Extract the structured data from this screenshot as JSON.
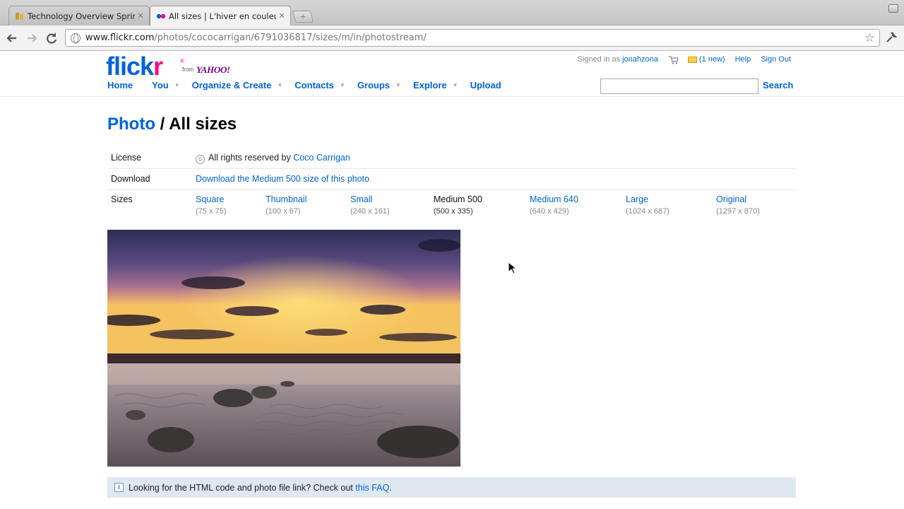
{
  "browser": {
    "tabs": [
      {
        "title": "Technology Overview Spring"
      },
      {
        "title": "All sizes | L'hiver en couleurs"
      }
    ],
    "new_tab_glyph": "+",
    "url_host": "www.flickr.com",
    "url_path": "/photos/cococarrigan/6791036817/sizes/m/in/photostream/"
  },
  "header": {
    "logo_text": "flickr",
    "logo_reg": "®",
    "from_label": "from",
    "yahoo_label": "YAHOO!",
    "signed_in_label": "Signed in as",
    "username": "jonahzona",
    "mail_count": "(1 new)",
    "help": "Help",
    "sign_out": "Sign Out",
    "nav": [
      {
        "label": "Home",
        "has_menu": false
      },
      {
        "label": "You",
        "has_menu": true
      },
      {
        "label": "Organize & Create",
        "has_menu": true
      },
      {
        "label": "Contacts",
        "has_menu": true
      },
      {
        "label": "Groups",
        "has_menu": true
      },
      {
        "label": "Explore",
        "has_menu": true
      },
      {
        "label": "Upload",
        "has_menu": false
      }
    ],
    "search_value": "",
    "search_button": "Search"
  },
  "main": {
    "heading_link": "Photo",
    "heading_rest": " / All sizes",
    "license_label": "License",
    "license_text": "All rights reserved by",
    "license_owner": "Coco Carrigan",
    "download_label": "Download",
    "download_link": "Download the Medium 500 size of this photo",
    "sizes_label": "Sizes",
    "sizes": [
      {
        "name": "Square",
        "dims": "(75 x 75)",
        "current": false
      },
      {
        "name": "Thumbnail",
        "dims": "(100 x 67)",
        "current": false
      },
      {
        "name": "Small",
        "dims": "(240 x 161)",
        "current": false
      },
      {
        "name": "Medium 500",
        "dims": "(500 x 335)",
        "current": true
      },
      {
        "name": "Medium 640",
        "dims": "(640 x 429)",
        "current": false
      },
      {
        "name": "Large",
        "dims": "(1024 x 687)",
        "current": false
      },
      {
        "name": "Original",
        "dims": "(1297 x 870)",
        "current": false
      }
    ],
    "faq_text": "Looking for the HTML code and photo file link? Check out",
    "faq_link": "this FAQ",
    "faq_end": "."
  },
  "colors": {
    "flickr_blue": "#0063dc",
    "flickr_pink": "#ff0084",
    "yahoo_purple": "#7b0099",
    "faq_bg": "#dfe7f1"
  },
  "icons": [
    "back-icon",
    "forward-icon",
    "reload-icon",
    "globe-icon",
    "star-icon",
    "wrench-icon",
    "cart-icon",
    "mail-icon",
    "copyright-icon",
    "info-icon",
    "cursor-icon"
  ]
}
